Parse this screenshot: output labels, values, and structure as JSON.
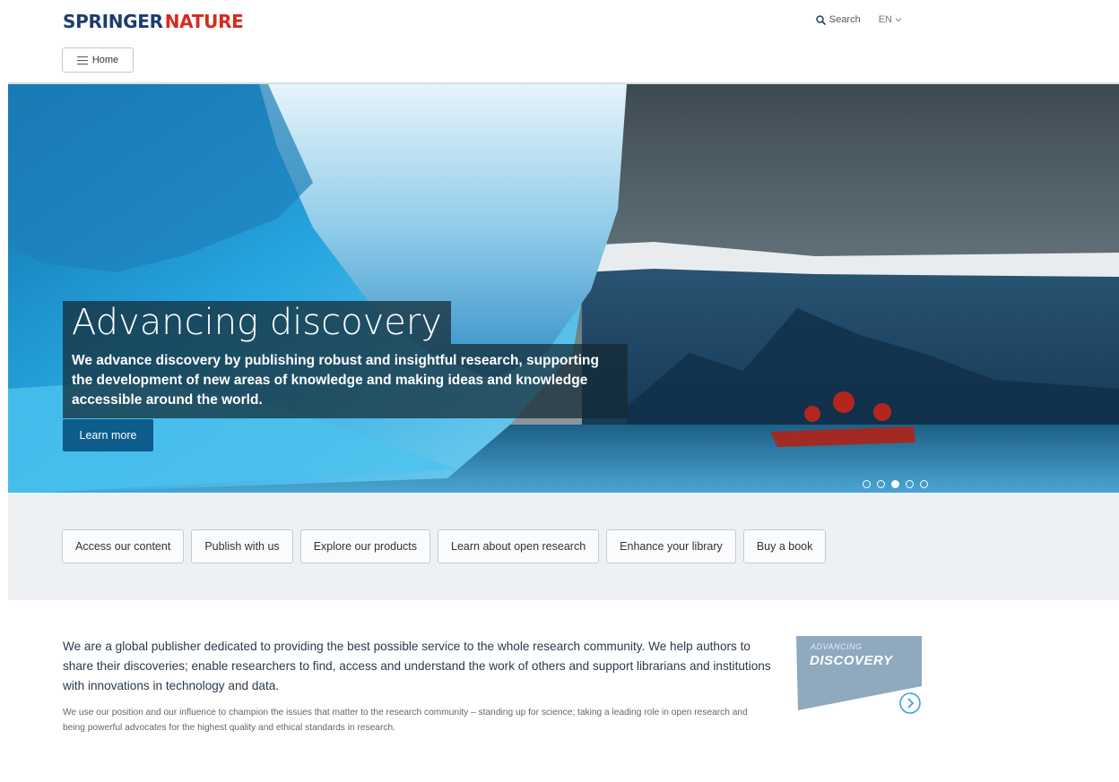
{
  "brand": {
    "part1": "SPRINGER",
    "part2": "NATURE",
    "color_dark": "#1b3d6e",
    "color_red": "#d52b1e"
  },
  "header": {
    "search_label": "Search",
    "lang_label": "EN",
    "search_icon": "magnifier-icon",
    "lang_icon": "chevron-down-icon"
  },
  "nav": {
    "home_label": "Home",
    "menu_icon": "hamburger-icon"
  },
  "hero": {
    "title": "Advancing discovery",
    "text": "We advance discovery by publishing robust and insightful research, supporting the development of new areas of knowledge and making ideas and knowledge accessible around the world.",
    "cta_label": "Learn more",
    "cta_color": "#0d5c8c",
    "slide_count": 5,
    "active_slide": 3
  },
  "quicklinks": [
    "Access our content",
    "Publish with us",
    "Explore our products",
    "Learn about open research",
    "Enhance your library",
    "Buy a book"
  ],
  "intro": {
    "main": "We are a global publisher dedicated to providing the best possible service to the whole research community. We help authors to share their discoveries; enable researchers to find, access and understand the work of others and support librarians and institutions with innovations in technology and data.",
    "sub": "We use our position and our influence to champion the issues that matter to the research community – standing up for science; taking a leading role in open research and being powerful advocates for the highest quality and ethical standards in research."
  },
  "badge": {
    "line1": "ADVANCING",
    "line2": "DISCOVERY",
    "color": "#8fa9bf",
    "arrow_icon": "circle-arrow-right-icon"
  }
}
